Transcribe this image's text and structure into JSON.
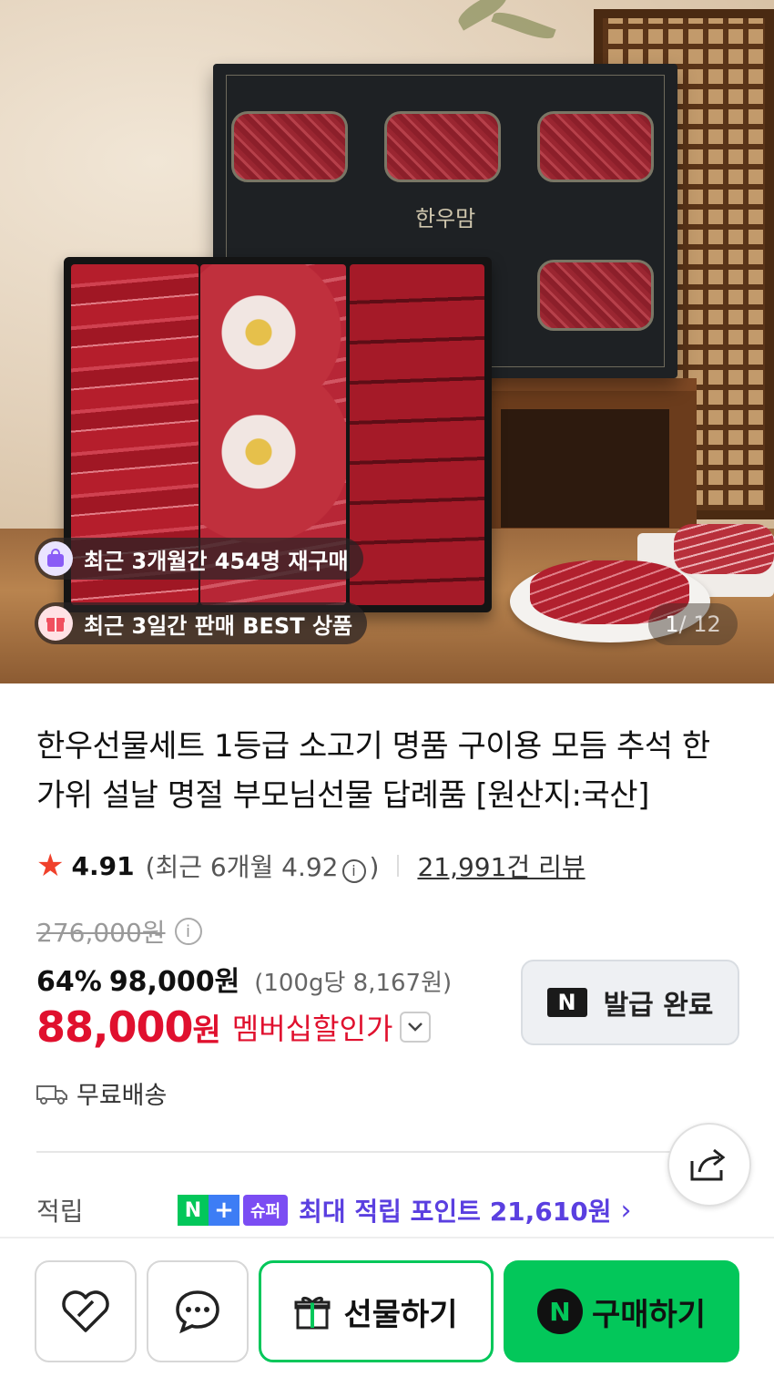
{
  "hero": {
    "badge_repurchase": "최근 3개월간 454명 재구매",
    "badge_best": "최근 3일간 판매 BEST 상품",
    "pager_current": "1",
    "pager_total": " / 12",
    "box_logo": "한우맘"
  },
  "product": {
    "title": "한우선물세트 1등급 소고기 명품 구이용 모듬 추석 한가위 설날 명절 부모님선물 답례품 [원산지:국산]",
    "rating": "4.91",
    "rating_recent_prefix": "(최근 6개월 4.92",
    "rating_recent_suffix": ")",
    "review_count": "21,991건 리뷰",
    "original_price": "276,000원",
    "discount": "64%",
    "price": "98,000원",
    "unit_price": "(100g당 8,167원)",
    "member_price": "88,000",
    "member_won": "원",
    "member_label": "멤버십할인가",
    "coupon_button": "발급 완료",
    "coupon_n": "N",
    "shipping": "무료배송",
    "points_label": "적립",
    "points_n": "N",
    "points_plus": "+",
    "points_super": "슈퍼",
    "points_text": "최대 적립 포인트 21,610원"
  },
  "bottom_bar": {
    "gift_label": "선물하기",
    "buy_label": "구매하기",
    "buy_n": "N"
  },
  "icons": {
    "badge_repurchase": "shopping-bag-icon",
    "badge_best": "gift-icon",
    "shipping": "truck-icon",
    "share": "share-icon",
    "wish": "heart-icon",
    "chat": "chat-icon",
    "gift": "gift-box-icon"
  },
  "colors": {
    "naver_green": "#03c75a",
    "member_red": "#e0102e",
    "points_purple": "#5a3fe0",
    "star": "#f0412b"
  }
}
